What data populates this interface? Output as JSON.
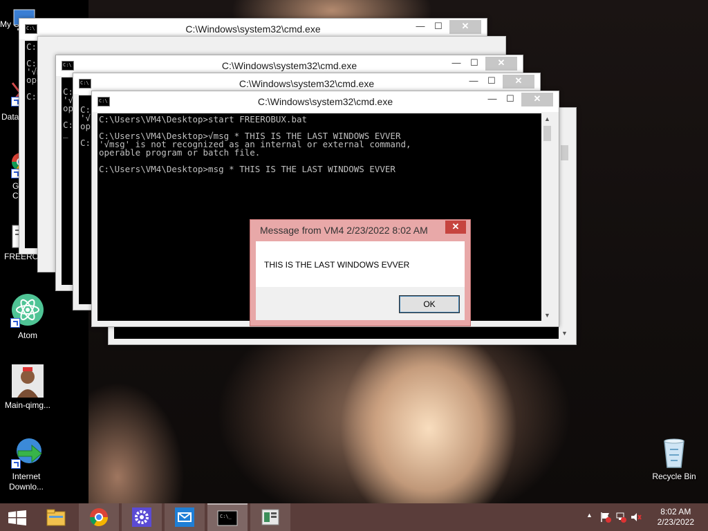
{
  "desktop": {
    "icons": [
      {
        "label": "My C",
        "icon": "computer-icon"
      },
      {
        "label": "Data",
        "icon": "data-icon"
      },
      {
        "label": "G C",
        "icon": "chrome-icon"
      },
      {
        "label": "FREEROE",
        "icon": "batch-file-icon"
      },
      {
        "label": "Atom",
        "icon": "atom-icon"
      },
      {
        "label": "Main-qimg...",
        "icon": "image-icon"
      },
      {
        "label": "Internet Downlo...",
        "icon": "download-manager-icon"
      },
      {
        "label": "Recycle Bin",
        "icon": "recycle-bin-icon"
      }
    ]
  },
  "cmd_windows": {
    "title": "C:\\Windows\\system32\\cmd.exe",
    "front_console": "C:\\Users\\VM4\\Desktop>start FREEROBUX.bat\n\nC:\\Users\\VM4\\Desktop>√msg * THIS IS THE LAST WINDOWS EVVER\n'√msg' is not recognized as an internal or external command,\noperable program or batch file.\n\nC:\\Users\\VM4\\Desktop>msg * THIS IS THE LAST WINDOWS EVVER",
    "back1_console": "C:\\Users\\VM4\\Desktop>start FREEROBUX.bat\n\nC:\\Users\\√msg\n'√msg\noperat\n\nC:\\Use",
    "back2_console": "\nC:\n'√\nop\n\nC:\n_",
    "back3_console": "\nC:\n'√\nop\n\nC:"
  },
  "message_box": {
    "title": "Message from VM4 2/23/2022 8:02 AM",
    "text": "THIS IS THE LAST WINDOWS EVVER",
    "ok_label": "OK",
    "close_glyph": "✕"
  },
  "taskbar": {
    "items": [
      "start-icon",
      "file-explorer-icon",
      "chrome-icon",
      "settings-icon",
      "mail-icon",
      "cmd-icon",
      "app-icon"
    ],
    "active_item": "cmd-icon",
    "clock": {
      "time": "8:02 AM",
      "date": "2/23/2022"
    },
    "accent_color": "#5a3d3a"
  }
}
